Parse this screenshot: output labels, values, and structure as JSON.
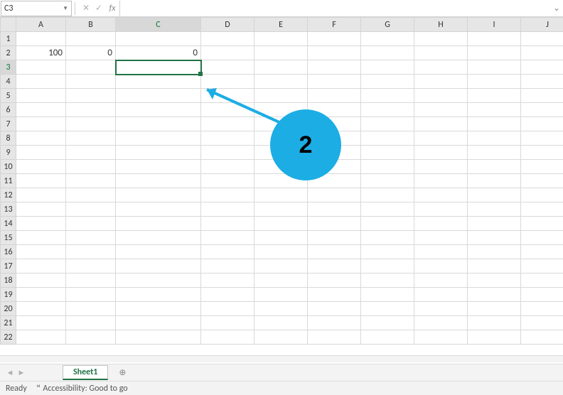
{
  "nameBox": {
    "value": "C3"
  },
  "formulaBar": {
    "value": "",
    "fxLabel": "fx"
  },
  "columns": [
    "A",
    "B",
    "C",
    "D",
    "E",
    "F",
    "G",
    "H",
    "I",
    "J"
  ],
  "rowCount": 22,
  "selectedCell": "C3",
  "cells": {
    "A2": "100",
    "B2": "0",
    "C2": "0"
  },
  "tabs": {
    "active": "Sheet1"
  },
  "status": {
    "text": "Ready",
    "accessibility": "Accessibility: Good to go"
  },
  "annotation": {
    "label": "2"
  },
  "colors": {
    "accent": "#217346",
    "annotation": "#1cade4"
  }
}
